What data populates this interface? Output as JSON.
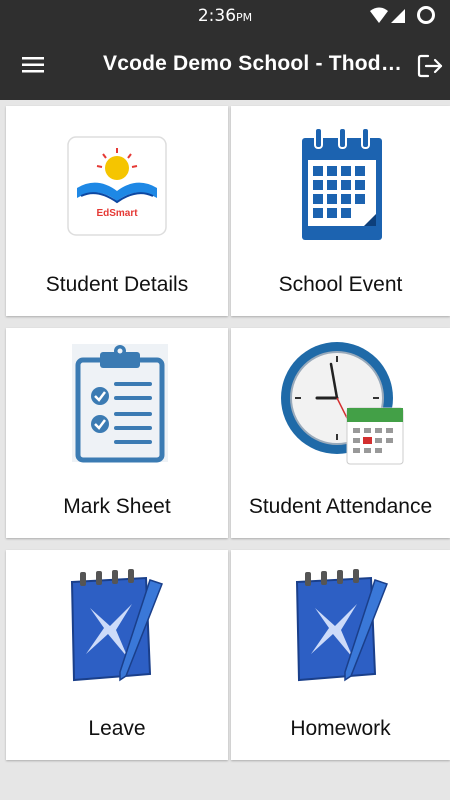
{
  "status_bar": {
    "time": "2:36",
    "ampm": "PM",
    "icons": [
      "wifi-icon",
      "signal-icon",
      "battery-icon"
    ]
  },
  "app_bar": {
    "title": "Vcode Demo School  -  Thodupuzha",
    "menu_icon": "hamburger-menu-icon",
    "logout_icon": "logout-icon"
  },
  "tiles": [
    {
      "label": "Student Details",
      "icon": "edsmart-logo-icon",
      "logo_text": "EdSmart"
    },
    {
      "label": "School Event",
      "icon": "calendar-icon"
    },
    {
      "label": "Mark Sheet",
      "icon": "clipboard-checklist-icon"
    },
    {
      "label": "Student Attendance",
      "icon": "clock-calendar-icon"
    },
    {
      "label": "Leave",
      "icon": "notepad-pen-icon"
    },
    {
      "label": "Homework",
      "icon": "notepad-pen-icon"
    }
  ],
  "colors": {
    "bar": "#2f2f2f",
    "background": "#e6e6e6",
    "card": "#ffffff",
    "calendar_blue": "#1c63b0",
    "clipboard_blue": "#3b7bb3",
    "notepad_blue": "#2d5fc4"
  }
}
